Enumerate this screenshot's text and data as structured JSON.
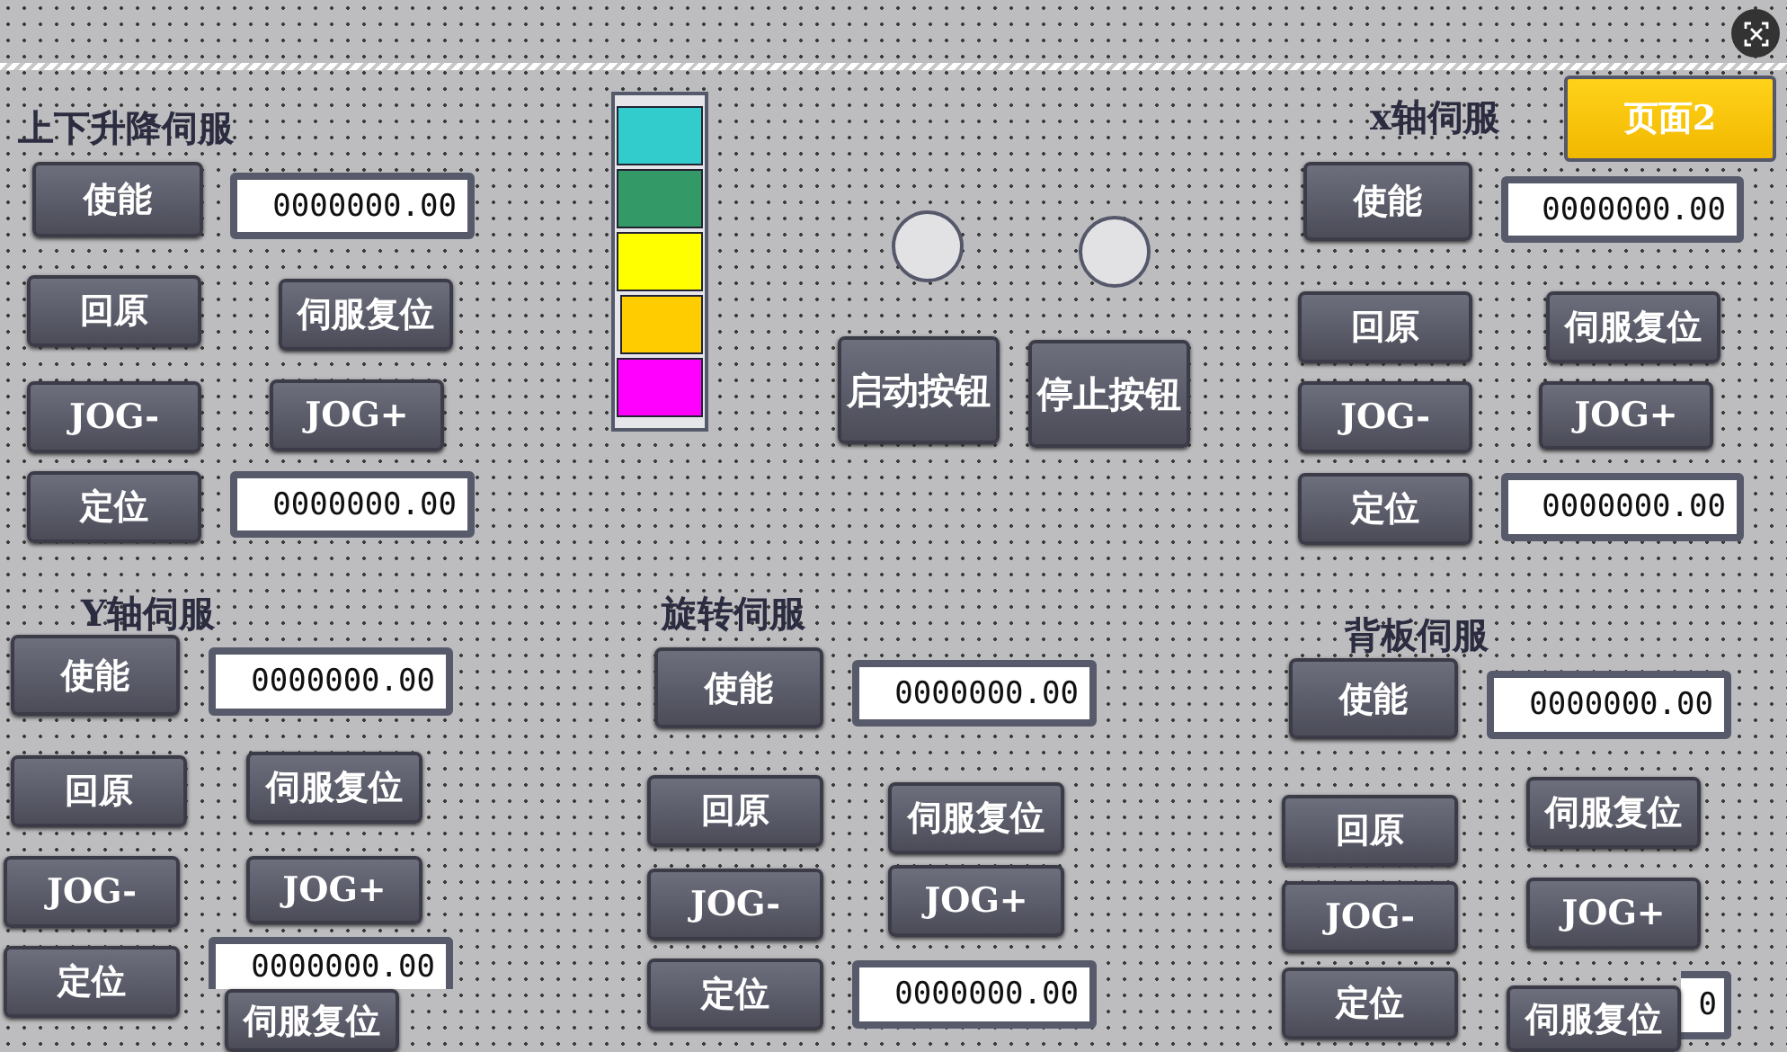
{
  "level_stack": {
    "segments": [
      {
        "color": "#33cccc"
      },
      {
        "color": "#339966"
      },
      {
        "color": "#ffff00"
      },
      {
        "color": "#ffcc00"
      },
      {
        "color": "#ff00ff"
      }
    ]
  },
  "page_button": "页面2",
  "start_stop_buttons": [
    "启动按钮",
    "停止按钮"
  ],
  "panels": [
    {
      "title": "上下升降伺服",
      "controls": [
        {
          "kind": "button",
          "label": "使能"
        },
        {
          "kind": "field",
          "value": "0000000.00"
        },
        {
          "kind": "button",
          "label": "回原"
        },
        {
          "kind": "button",
          "label": "伺服复位"
        },
        {
          "kind": "button",
          "label": "JOG-"
        },
        {
          "kind": "button",
          "label": "JOG+"
        },
        {
          "kind": "button",
          "label": "定位"
        },
        {
          "kind": "field",
          "value": "0000000.00"
        }
      ]
    },
    {
      "title": "x轴伺服",
      "controls": [
        {
          "kind": "button",
          "label": "使能"
        },
        {
          "kind": "field",
          "value": "0000000.00"
        },
        {
          "kind": "button",
          "label": "回原"
        },
        {
          "kind": "button",
          "label": "伺服复位"
        },
        {
          "kind": "button",
          "label": "JOG-"
        },
        {
          "kind": "button",
          "label": "JOG+"
        },
        {
          "kind": "button",
          "label": "定位"
        },
        {
          "kind": "field",
          "value": "0000000.00"
        }
      ]
    },
    {
      "title": "Y轴伺服",
      "controls": [
        {
          "kind": "button",
          "label": "使能"
        },
        {
          "kind": "field",
          "value": "0000000.00"
        },
        {
          "kind": "button",
          "label": "回原"
        },
        {
          "kind": "button",
          "label": "伺服复位"
        },
        {
          "kind": "button",
          "label": "JOG-"
        },
        {
          "kind": "button",
          "label": "JOG+"
        },
        {
          "kind": "button",
          "label": "定位"
        },
        {
          "kind": "field",
          "value": "0000000.00"
        }
      ]
    },
    {
      "title": "旋转伺服",
      "controls": [
        {
          "kind": "button",
          "label": "使能"
        },
        {
          "kind": "field",
          "value": "0000000.00"
        },
        {
          "kind": "button",
          "label": "回原"
        },
        {
          "kind": "button",
          "label": "伺服复位"
        },
        {
          "kind": "button",
          "label": "JOG-"
        },
        {
          "kind": "button",
          "label": "JOG+"
        },
        {
          "kind": "button",
          "label": "定位"
        },
        {
          "kind": "field",
          "value": "0000000.00"
        }
      ]
    },
    {
      "title": "背板伺服",
      "controls": [
        {
          "kind": "button",
          "label": "使能"
        },
        {
          "kind": "field",
          "value": "0000000.00"
        },
        {
          "kind": "button",
          "label": "回原"
        },
        {
          "kind": "button",
          "label": "伺服复位"
        },
        {
          "kind": "button",
          "label": "JOG-"
        },
        {
          "kind": "button",
          "label": "JOG+"
        },
        {
          "kind": "button",
          "label": "定位"
        },
        {
          "kind": "field",
          "value": "0"
        }
      ]
    }
  ],
  "overlay_buttons": [
    "伺服复位",
    "伺服复位"
  ]
}
